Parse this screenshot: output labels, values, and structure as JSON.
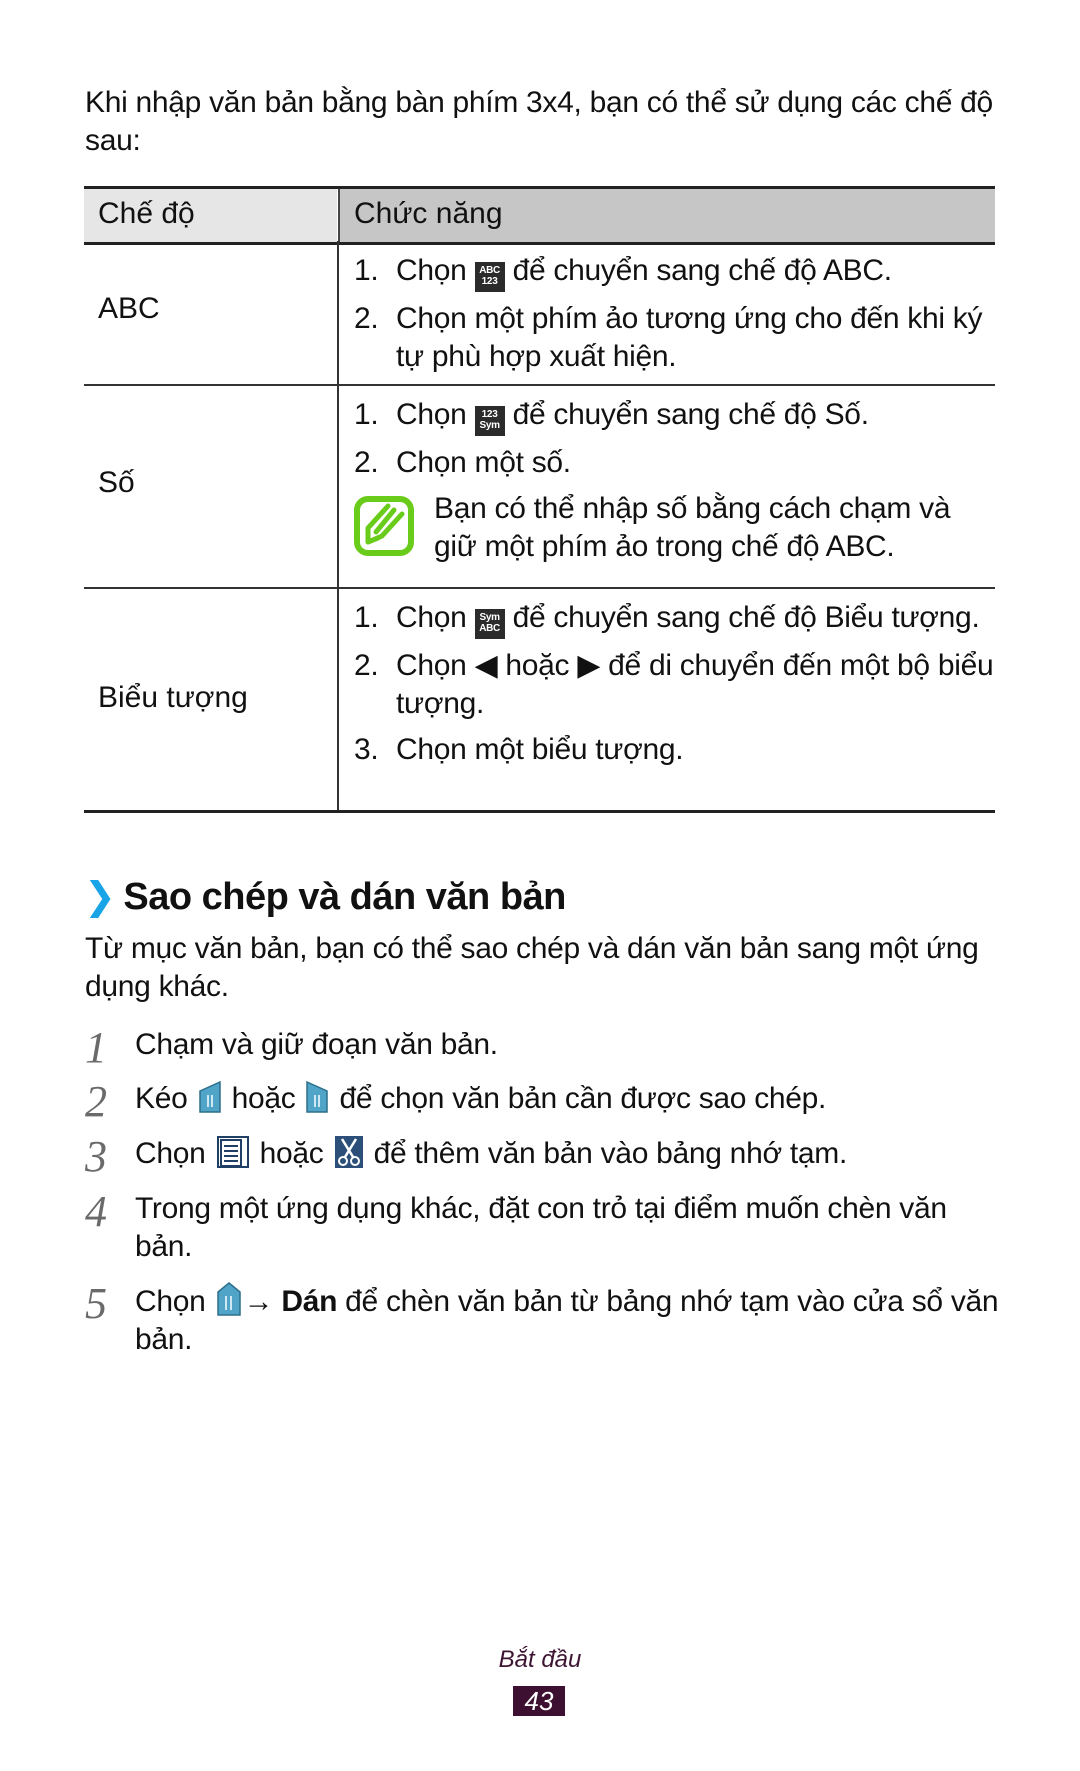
{
  "intro": "Khi nhập văn bản bằng bàn phím 3x4, bạn có thể sử dụng các chế độ sau:",
  "table": {
    "headers": [
      "Chế độ",
      "Chức năng"
    ],
    "rows": [
      {
        "mode": "ABC",
        "items": [
          {
            "num": "1.",
            "pre": "Chọn",
            "key": [
              "ABC",
              "123"
            ],
            "post": "để chuyển sang chế độ ABC."
          },
          {
            "num": "2.",
            "text": "Chọn một phím ảo tương ứng cho đến khi ký tự phù hợp xuất hiện."
          }
        ]
      },
      {
        "mode": "Số",
        "items": [
          {
            "num": "1.",
            "pre": "Chọn",
            "key": [
              "123",
              "Sym"
            ],
            "post": "để chuyển sang chế độ Số."
          },
          {
            "num": "2.",
            "text": "Chọn một số."
          }
        ],
        "note": "Bạn có thể nhập số bằng cách chạm và giữ một phím ảo trong chế độ ABC."
      },
      {
        "mode": "Biểu tượng",
        "items": [
          {
            "num": "1.",
            "pre": "Chọn",
            "key": [
              "Sym",
              "ABC"
            ],
            "post": "để chuyển sang chế độ Biểu tượng."
          },
          {
            "num": "2.",
            "pre": "Chọn",
            "left_arrow": "◀",
            "mid": "hoặc",
            "right_arrow": "▶",
            "post": "để di chuyển đến một bộ biểu tượng."
          },
          {
            "num": "3.",
            "text": "Chọn một biểu tượng."
          }
        ]
      }
    ]
  },
  "section": {
    "chevron": "❯",
    "title": "Sao chép và dán văn bản",
    "intro": "Từ mục văn bản, bạn có thể sao chép và dán văn bản sang một ứng dụng khác.",
    "steps": [
      {
        "num": "1",
        "text": "Chạm và giữ đoạn văn bản."
      },
      {
        "num": "2",
        "pre": "Kéo",
        "mid": "hoặc",
        "post": "để chọn văn bản cần được sao chép.",
        "icons": [
          "left-selection-handle-icon",
          "right-selection-handle-icon"
        ]
      },
      {
        "num": "3",
        "pre": "Chọn",
        "mid": "hoặc",
        "post": "để thêm văn bản vào bảng nhớ tạm.",
        "icons": [
          "copy-icon",
          "cut-icon"
        ]
      },
      {
        "num": "4",
        "text": "Trong một ứng dụng khác, đặt con trỏ tại điểm muốn chèn văn bản."
      },
      {
        "num": "5",
        "pre": "Chọn",
        "arrow": "→",
        "bold": "Dán",
        "post": "để chèn văn bản từ bảng nhớ tạm vào cửa sổ văn bản.",
        "icons": [
          "cursor-handle-icon"
        ]
      }
    ]
  },
  "footer": {
    "chapter": "Bắt đầu",
    "page": "43"
  },
  "colors": {
    "accent_chevron": "#1aa4e8",
    "note_icon": "#6acc1a",
    "footer": "#3d0f30",
    "header_left": "#e6e6e6",
    "header_right": "#c6c6c6"
  }
}
